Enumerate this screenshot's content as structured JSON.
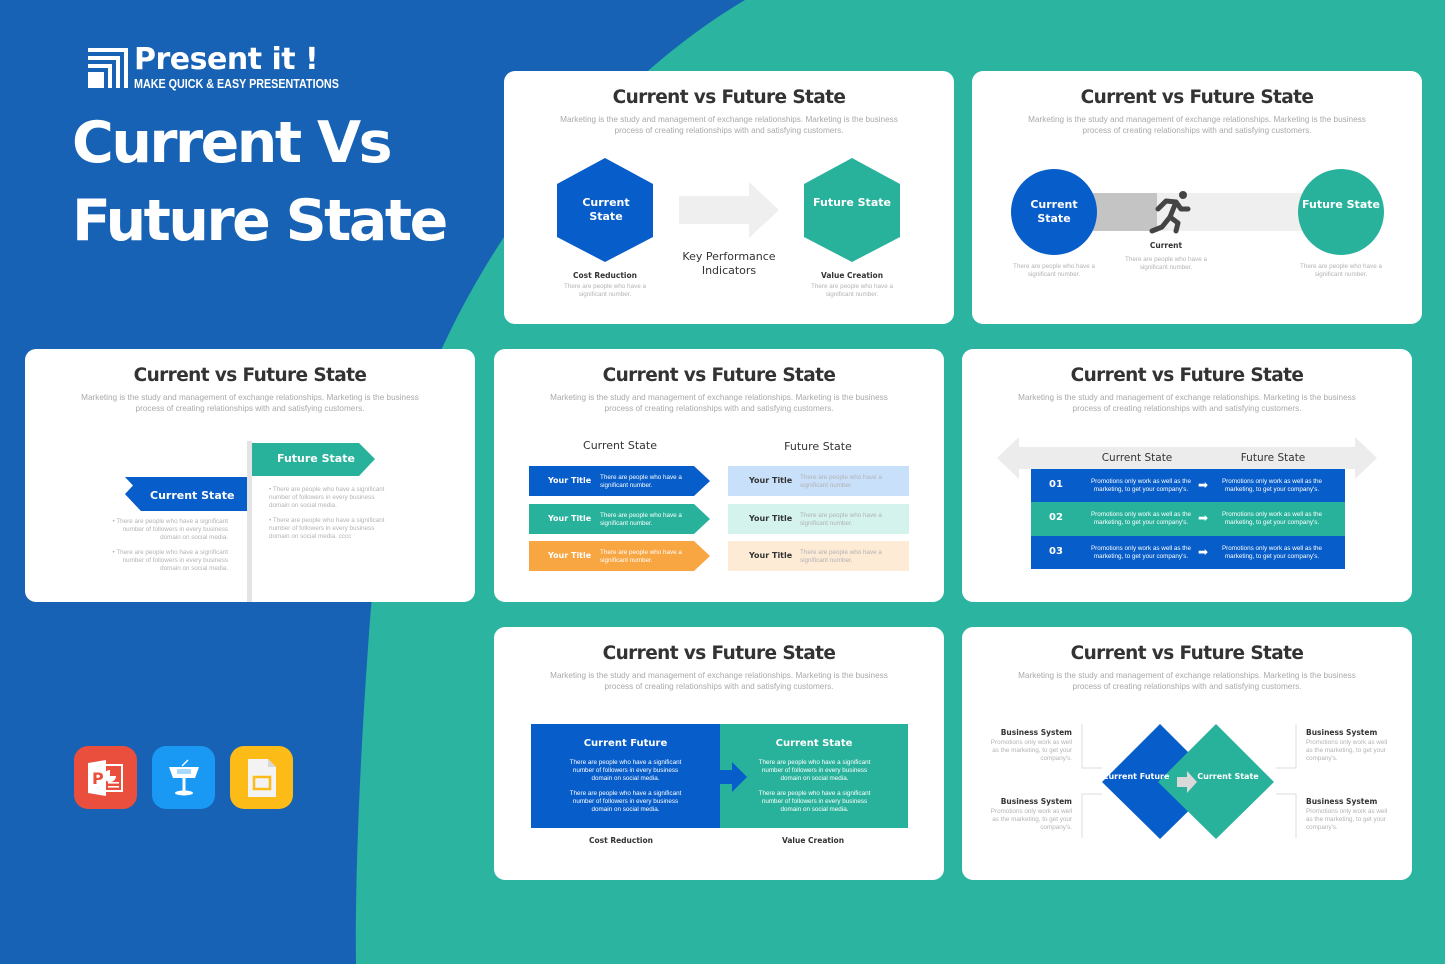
{
  "colors": {
    "blue_bg": "#1762b4",
    "teal_bg": "#2bb5a0",
    "blue": "#075dc9",
    "teal": "#28b29c",
    "orange": "#f7a642",
    "light_blue": "#c9e0fb",
    "light_teal": "#d3f3ec",
    "light_orange": "#fdebd6",
    "gray": "#efefef"
  },
  "brand": {
    "name": "Present it !",
    "tagline": "MAKE QUICK & EASY PRESENTATIONS",
    "icon": "presentit-logo-icon"
  },
  "hero": {
    "line1": "Current Vs",
    "line2": "Future State"
  },
  "apps": [
    {
      "name": "PowerPoint",
      "icon": "powerpoint-icon",
      "color": "#ea4f3d"
    },
    {
      "name": "Keynote",
      "icon": "keynote-icon",
      "color": "#1a99f4"
    },
    {
      "name": "Google Slides",
      "icon": "google-slides-icon",
      "color": "#fcbb16"
    }
  ],
  "common": {
    "title": "Current vs Future State",
    "subtitle": "Marketing is the study and management of exchange relationships. Marketing is the business process of creating relationships with and satisfying customers."
  },
  "slide1": {
    "left_shape": "Current State",
    "right_shape": "Future State",
    "center_label": "Key Performance Indicators",
    "left_caption": "Cost Reduction",
    "left_text": "There are people who have a significant number.",
    "right_caption": "Value Creation",
    "right_text": "There are people who have a significant number."
  },
  "slide2": {
    "left_circle": "Current State",
    "right_circle": "Future State",
    "runner_icon": "running-person-icon",
    "center_label": "Current",
    "center_text": "There are people who have a significant number.",
    "left_text": "There are people who have a significant number.",
    "right_text": "There are people who have a significant number."
  },
  "slide3": {
    "left_arrow": "Current State",
    "right_arrow": "Future State",
    "left_bullets": [
      "There are people who have a significant number of followers in every business domain on social media.",
      "There are people who have a significant number of followers in every business domain on social media."
    ],
    "right_bullets": [
      "There are people who have a significant number of followers in every business domain on social media.",
      "There are people who have a significant number of followers in every business domain on social media. cccc"
    ]
  },
  "slide4": {
    "left_header": "Current State",
    "right_header": "Future State",
    "left_items": [
      {
        "title": "Your Title",
        "text": "There are people who have a significant number."
      },
      {
        "title": "Your Title",
        "text": "There are people who have a significant number."
      },
      {
        "title": "Your Title",
        "text": "There are people who have a significant number."
      }
    ],
    "right_items": [
      {
        "title": "Your Title",
        "text": "There are people who have a significant number."
      },
      {
        "title": "Your Title",
        "text": "There are people who have a significant number."
      },
      {
        "title": "Your Title",
        "text": "There are people who have a significant number."
      }
    ]
  },
  "slide5": {
    "left_header": "Current State",
    "right_header": "Future State",
    "rows": [
      {
        "num": "01",
        "current": "Promotions only work as well as the marketing, to get your company's.",
        "future": "Promotions only work as well as the marketing, to get your company's."
      },
      {
        "num": "02",
        "current": "Promotions only work as well as the marketing, to get your company's.",
        "future": "Promotions only work as well as the marketing, to get your company's."
      },
      {
        "num": "03",
        "current": "Promotions only work as well as the marketing, to get your company's.",
        "future": "Promotions only work as well as the marketing, to get your company's."
      }
    ]
  },
  "slide6": {
    "left_title": "Current Future",
    "right_title": "Current State",
    "left_paras": [
      "There are people who have a significant number of followers in every business domain on social media.",
      "There are people who have a significant number of followers in every business domain on social media."
    ],
    "right_paras": [
      "There are people who have a significant number of followers in every business domain on social media.",
      "There are people who have a significant number of followers in every business domain on social media."
    ],
    "left_caption": "Cost Reduction",
    "right_caption": "Value Creation"
  },
  "slide7": {
    "left_diamond": "Current Future",
    "right_diamond": "Current State",
    "blocks": [
      {
        "title": "Business System",
        "text": "Promotions only work as well as the marketing, to get your company's."
      },
      {
        "title": "Business System",
        "text": "Promotions only work as well as the marketing, to get your company's."
      },
      {
        "title": "Business System",
        "text": "Promotions only work as well as the marketing, to get your company's."
      },
      {
        "title": "Business System",
        "text": "Promotions only work as well as the marketing, to get your company's."
      }
    ]
  }
}
